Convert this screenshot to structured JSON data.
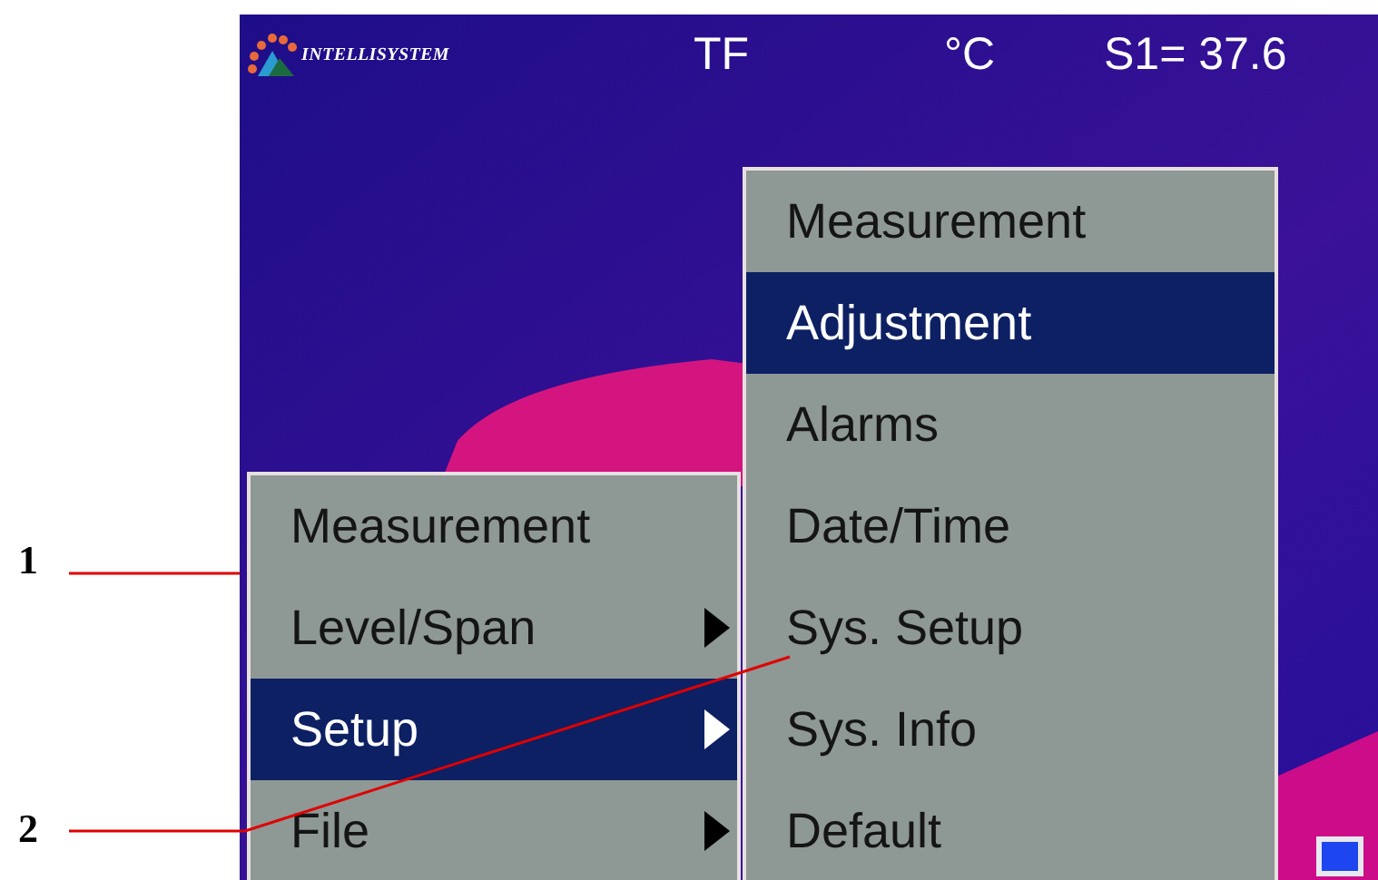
{
  "header": {
    "logo": "INTELLISYSTEM",
    "mode": "TF",
    "unit": "°C",
    "reading": "S1= 37.6"
  },
  "main_menu": {
    "items": [
      {
        "label": "Measurement",
        "has_submenu": false,
        "selected": false
      },
      {
        "label": "Level/Span",
        "has_submenu": true,
        "selected": false
      },
      {
        "label": "Setup",
        "has_submenu": true,
        "selected": true
      },
      {
        "label": "File",
        "has_submenu": true,
        "selected": false
      }
    ]
  },
  "sub_menu": {
    "items": [
      {
        "label": "Measurement",
        "selected": false
      },
      {
        "label": "Adjustment",
        "selected": true
      },
      {
        "label": "Alarms",
        "selected": false
      },
      {
        "label": "Date/Time",
        "selected": false
      },
      {
        "label": "Sys. Setup",
        "selected": false
      },
      {
        "label": "Sys. Info",
        "selected": false
      },
      {
        "label": "Default",
        "selected": false
      }
    ]
  },
  "callouts": [
    {
      "label": "1"
    },
    {
      "label": "2"
    }
  ]
}
